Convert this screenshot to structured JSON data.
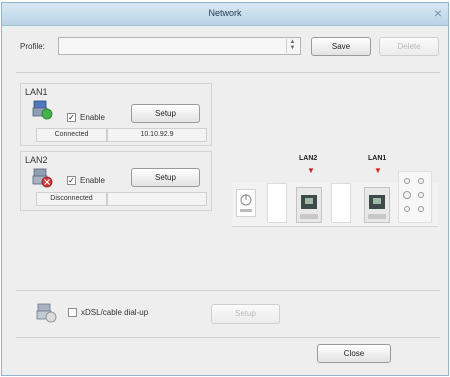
{
  "window": {
    "title": "Network"
  },
  "profile": {
    "label": "Profile:",
    "value": "",
    "save_label": "Save",
    "delete_label": "Delete"
  },
  "lan1": {
    "title": "LAN1",
    "enable_label": "Enable",
    "enabled": true,
    "setup_label": "Setup",
    "status": "Connected",
    "ip": "10.10.92.9"
  },
  "lan2": {
    "title": "LAN2",
    "enable_label": "Enable",
    "enabled": true,
    "setup_label": "Setup",
    "status": "Disconnected",
    "ip": ""
  },
  "diagram": {
    "lan2_label": "LAN2",
    "lan1_label": "LAN1",
    "arrow": "▼"
  },
  "dialup": {
    "label": "xDSL/cable dial-up",
    "checked": false,
    "setup_label": "Setup"
  },
  "footer": {
    "close_label": "Close"
  },
  "icons": {
    "checkmark": "✓",
    "combo_up": "▲",
    "combo_down": "▼",
    "close": "×"
  }
}
